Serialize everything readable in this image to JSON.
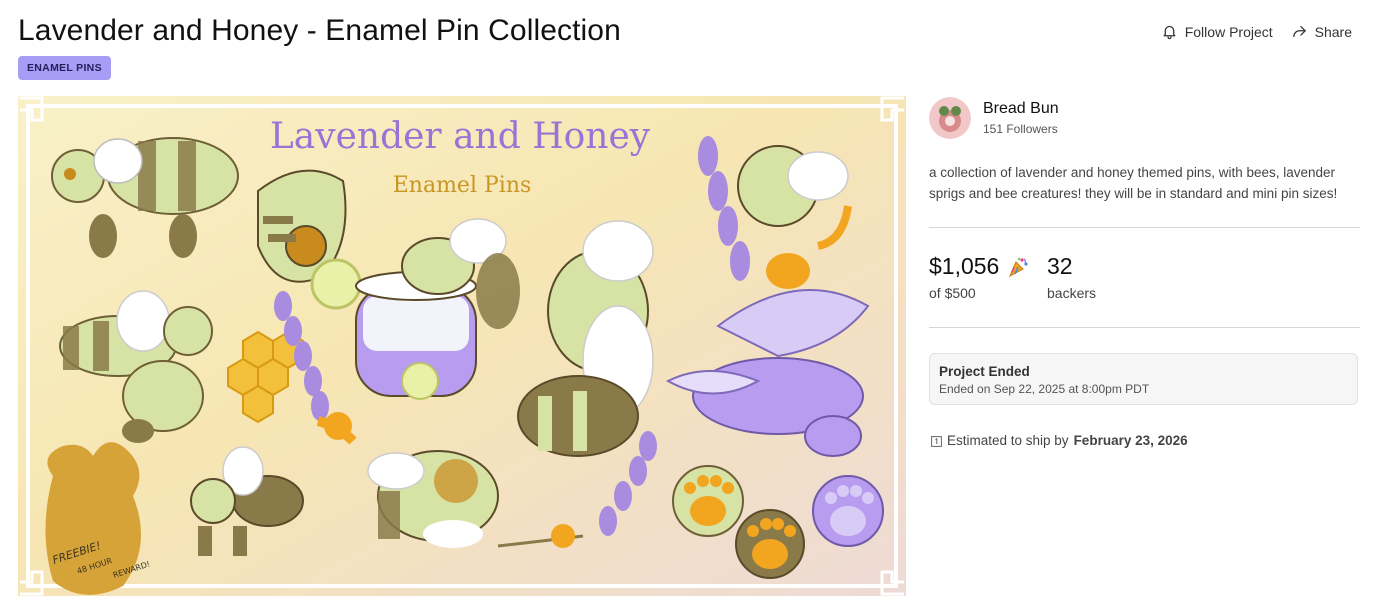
{
  "project": {
    "title": "Lavender and Honey - Enamel Pin Collection",
    "category_tag": "ENAMEL PINS",
    "blurb": "a collection of lavender and honey themed pins, with bees, lavender sprigs and bee creatures! they will be in standard and mini pin sizes!"
  },
  "actions": {
    "follow_label": "Follow Project",
    "share_label": "Share"
  },
  "hero_image": {
    "title_line": "Lavender and Honey",
    "subtitle_line": "Enamel Pins",
    "freebie_line1": "FREEBIE!",
    "freebie_line2": "48 HOUR",
    "freebie_line3": "REWARD!"
  },
  "creator": {
    "name": "Bread Bun",
    "followers": "151 Followers"
  },
  "stats": {
    "raised": "$1,056",
    "goal": "of $500",
    "backers_count": "32",
    "backers_label": "backers",
    "celebration_icon": "party-popper-icon"
  },
  "status": {
    "title": "Project Ended",
    "ended_on": "Ended on Sep 22, 2025 at 8:00pm PDT"
  },
  "shipping": {
    "prefix": "Estimated to ship by",
    "date": "February 23, 2026"
  },
  "colors": {
    "tag_bg": "#a99cf6",
    "lavender": "#a98be0",
    "honey": "#f2a51f",
    "pin_green": "#d7e3a5",
    "pin_brown": "#8a7a4a"
  }
}
